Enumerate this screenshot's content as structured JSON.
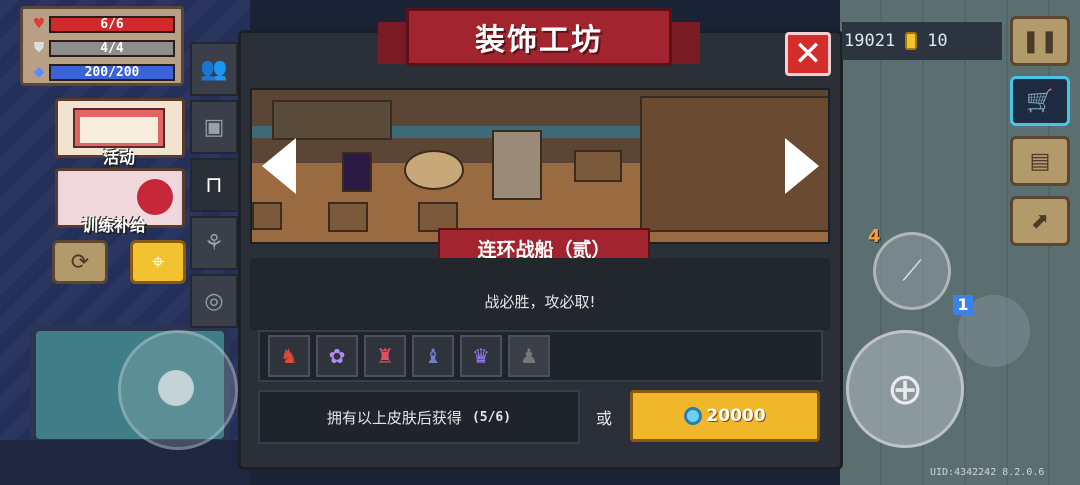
{
  "player": {
    "hp": "6/6",
    "armor": "4/4",
    "energy": "200/200"
  },
  "left_panel": {
    "activity_label": "活动",
    "training_label": "训练补给"
  },
  "modal": {
    "title": "装饰工坊",
    "set_name": "连环战船（贰）",
    "description": "战必胜，攻必取!",
    "requirement_text": "拥有以上皮肤后获得",
    "requirement_progress": "(5/6)",
    "or_label": "或",
    "price": "20000"
  },
  "hud": {
    "gems": "19021",
    "coins": "10"
  },
  "controls": {
    "skill_charges": "4",
    "weapon_slot": "1"
  },
  "footer": {
    "uid": "UID:4342242 8.2.0.6"
  },
  "colors": {
    "accent_red": "#a2242e",
    "buy_gold": "#f1b72a",
    "panel_dark": "#2a2f38"
  }
}
